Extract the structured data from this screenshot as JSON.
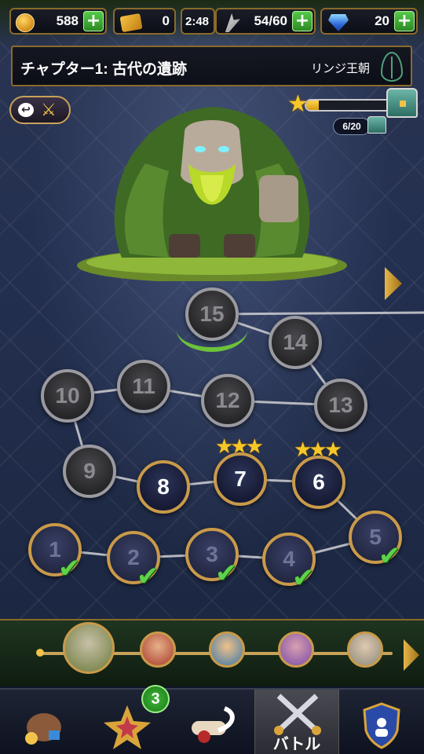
{
  "resources": {
    "gold": "588",
    "tickets": "0",
    "timer": "2:48",
    "energy": "54/60",
    "gems": "20"
  },
  "chapter": {
    "title": "チャプター1: 古代の遺跡",
    "dynasty": "リンジ王朝"
  },
  "progress": {
    "stars_fraction": 0.15,
    "chest_count": "6/20"
  },
  "levels": [
    {
      "label": "1",
      "state": "done"
    },
    {
      "label": "2",
      "state": "done"
    },
    {
      "label": "3",
      "state": "done"
    },
    {
      "label": "4",
      "state": "done"
    },
    {
      "label": "5",
      "state": "done"
    },
    {
      "label": "6",
      "state": "open",
      "stars": 3
    },
    {
      "label": "7",
      "state": "open",
      "stars": 3
    },
    {
      "label": "8",
      "state": "open",
      "stars": 0
    },
    {
      "label": "9",
      "state": "locked"
    },
    {
      "label": "10",
      "state": "locked"
    },
    {
      "label": "11",
      "state": "locked"
    },
    {
      "label": "12",
      "state": "locked"
    },
    {
      "label": "13",
      "state": "locked"
    },
    {
      "label": "14",
      "state": "locked"
    },
    {
      "label": "15",
      "state": "locked",
      "boss": true
    }
  ],
  "nav": {
    "battle_label": "バトル",
    "hero_badge": "3"
  },
  "colors": {
    "accent_gold": "#c99a4a",
    "plus_green": "#3fb53a",
    "check_green": "#5ed24a",
    "star_yellow": "#f7c728"
  }
}
